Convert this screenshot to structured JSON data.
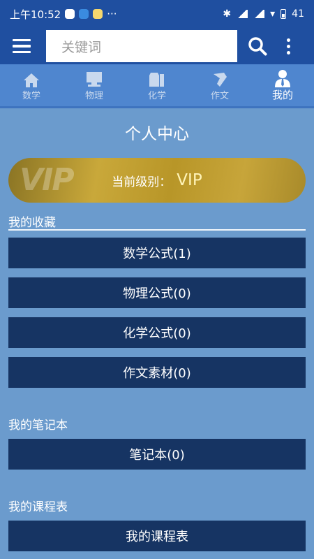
{
  "status_bar": {
    "time": "上午10:52",
    "dots": "···",
    "battery": "41"
  },
  "toolbar": {
    "search_placeholder": "关键词"
  },
  "tabs": [
    {
      "label": "数学",
      "icon": "house-icon"
    },
    {
      "label": "物理",
      "icon": "computer-icon"
    },
    {
      "label": "化学",
      "icon": "flask-icon"
    },
    {
      "label": "作文",
      "icon": "pen-icon"
    },
    {
      "label": "我的",
      "icon": "person-icon",
      "active": true
    }
  ],
  "page": {
    "title": "个人中心"
  },
  "vip": {
    "label": "当前级别：",
    "level": "VIP",
    "logo": "VIP"
  },
  "favorites": {
    "label": "我的收藏",
    "items": [
      "数学公式(1)",
      "物理公式(0)",
      "化学公式(0)",
      "作文素材(0)"
    ]
  },
  "notebook": {
    "label": "我的笔记本",
    "button": "笔记本(0)"
  },
  "schedule": {
    "label": "我的课程表",
    "button": "我的课程表"
  },
  "colors": {
    "status_bar": "#1f4fa0",
    "tab_bar": "#4f86cf",
    "background": "#6b9bcd",
    "button": "#163463",
    "vip_gold": "#c9a83a"
  }
}
